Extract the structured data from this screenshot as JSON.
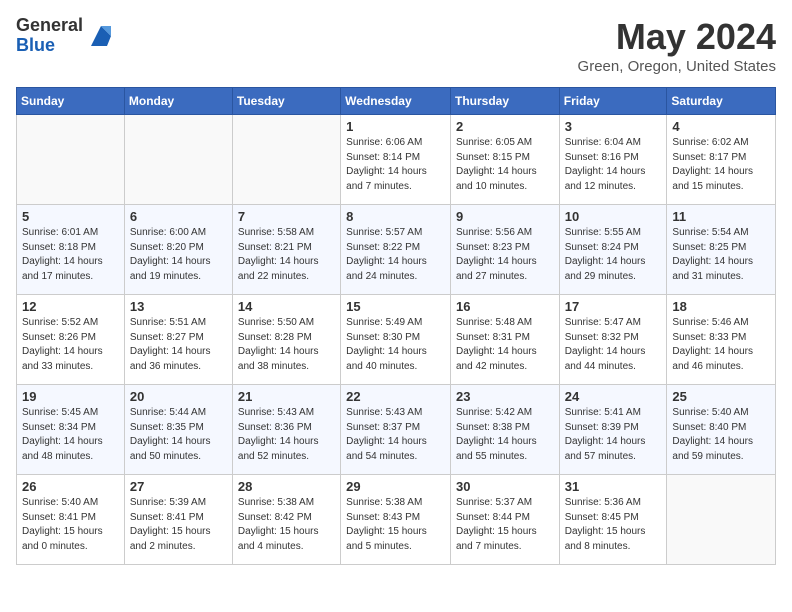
{
  "header": {
    "logo_general": "General",
    "logo_blue": "Blue",
    "month_title": "May 2024",
    "location": "Green, Oregon, United States"
  },
  "weekdays": [
    "Sunday",
    "Monday",
    "Tuesday",
    "Wednesday",
    "Thursday",
    "Friday",
    "Saturday"
  ],
  "weeks": [
    [
      {
        "day": "",
        "info": ""
      },
      {
        "day": "",
        "info": ""
      },
      {
        "day": "",
        "info": ""
      },
      {
        "day": "1",
        "info": "Sunrise: 6:06 AM\nSunset: 8:14 PM\nDaylight: 14 hours\nand 7 minutes."
      },
      {
        "day": "2",
        "info": "Sunrise: 6:05 AM\nSunset: 8:15 PM\nDaylight: 14 hours\nand 10 minutes."
      },
      {
        "day": "3",
        "info": "Sunrise: 6:04 AM\nSunset: 8:16 PM\nDaylight: 14 hours\nand 12 minutes."
      },
      {
        "day": "4",
        "info": "Sunrise: 6:02 AM\nSunset: 8:17 PM\nDaylight: 14 hours\nand 15 minutes."
      }
    ],
    [
      {
        "day": "5",
        "info": "Sunrise: 6:01 AM\nSunset: 8:18 PM\nDaylight: 14 hours\nand 17 minutes."
      },
      {
        "day": "6",
        "info": "Sunrise: 6:00 AM\nSunset: 8:20 PM\nDaylight: 14 hours\nand 19 minutes."
      },
      {
        "day": "7",
        "info": "Sunrise: 5:58 AM\nSunset: 8:21 PM\nDaylight: 14 hours\nand 22 minutes."
      },
      {
        "day": "8",
        "info": "Sunrise: 5:57 AM\nSunset: 8:22 PM\nDaylight: 14 hours\nand 24 minutes."
      },
      {
        "day": "9",
        "info": "Sunrise: 5:56 AM\nSunset: 8:23 PM\nDaylight: 14 hours\nand 27 minutes."
      },
      {
        "day": "10",
        "info": "Sunrise: 5:55 AM\nSunset: 8:24 PM\nDaylight: 14 hours\nand 29 minutes."
      },
      {
        "day": "11",
        "info": "Sunrise: 5:54 AM\nSunset: 8:25 PM\nDaylight: 14 hours\nand 31 minutes."
      }
    ],
    [
      {
        "day": "12",
        "info": "Sunrise: 5:52 AM\nSunset: 8:26 PM\nDaylight: 14 hours\nand 33 minutes."
      },
      {
        "day": "13",
        "info": "Sunrise: 5:51 AM\nSunset: 8:27 PM\nDaylight: 14 hours\nand 36 minutes."
      },
      {
        "day": "14",
        "info": "Sunrise: 5:50 AM\nSunset: 8:28 PM\nDaylight: 14 hours\nand 38 minutes."
      },
      {
        "day": "15",
        "info": "Sunrise: 5:49 AM\nSunset: 8:30 PM\nDaylight: 14 hours\nand 40 minutes."
      },
      {
        "day": "16",
        "info": "Sunrise: 5:48 AM\nSunset: 8:31 PM\nDaylight: 14 hours\nand 42 minutes."
      },
      {
        "day": "17",
        "info": "Sunrise: 5:47 AM\nSunset: 8:32 PM\nDaylight: 14 hours\nand 44 minutes."
      },
      {
        "day": "18",
        "info": "Sunrise: 5:46 AM\nSunset: 8:33 PM\nDaylight: 14 hours\nand 46 minutes."
      }
    ],
    [
      {
        "day": "19",
        "info": "Sunrise: 5:45 AM\nSunset: 8:34 PM\nDaylight: 14 hours\nand 48 minutes."
      },
      {
        "day": "20",
        "info": "Sunrise: 5:44 AM\nSunset: 8:35 PM\nDaylight: 14 hours\nand 50 minutes."
      },
      {
        "day": "21",
        "info": "Sunrise: 5:43 AM\nSunset: 8:36 PM\nDaylight: 14 hours\nand 52 minutes."
      },
      {
        "day": "22",
        "info": "Sunrise: 5:43 AM\nSunset: 8:37 PM\nDaylight: 14 hours\nand 54 minutes."
      },
      {
        "day": "23",
        "info": "Sunrise: 5:42 AM\nSunset: 8:38 PM\nDaylight: 14 hours\nand 55 minutes."
      },
      {
        "day": "24",
        "info": "Sunrise: 5:41 AM\nSunset: 8:39 PM\nDaylight: 14 hours\nand 57 minutes."
      },
      {
        "day": "25",
        "info": "Sunrise: 5:40 AM\nSunset: 8:40 PM\nDaylight: 14 hours\nand 59 minutes."
      }
    ],
    [
      {
        "day": "26",
        "info": "Sunrise: 5:40 AM\nSunset: 8:41 PM\nDaylight: 15 hours\nand 0 minutes."
      },
      {
        "day": "27",
        "info": "Sunrise: 5:39 AM\nSunset: 8:41 PM\nDaylight: 15 hours\nand 2 minutes."
      },
      {
        "day": "28",
        "info": "Sunrise: 5:38 AM\nSunset: 8:42 PM\nDaylight: 15 hours\nand 4 minutes."
      },
      {
        "day": "29",
        "info": "Sunrise: 5:38 AM\nSunset: 8:43 PM\nDaylight: 15 hours\nand 5 minutes."
      },
      {
        "day": "30",
        "info": "Sunrise: 5:37 AM\nSunset: 8:44 PM\nDaylight: 15 hours\nand 7 minutes."
      },
      {
        "day": "31",
        "info": "Sunrise: 5:36 AM\nSunset: 8:45 PM\nDaylight: 15 hours\nand 8 minutes."
      },
      {
        "day": "",
        "info": ""
      }
    ]
  ]
}
